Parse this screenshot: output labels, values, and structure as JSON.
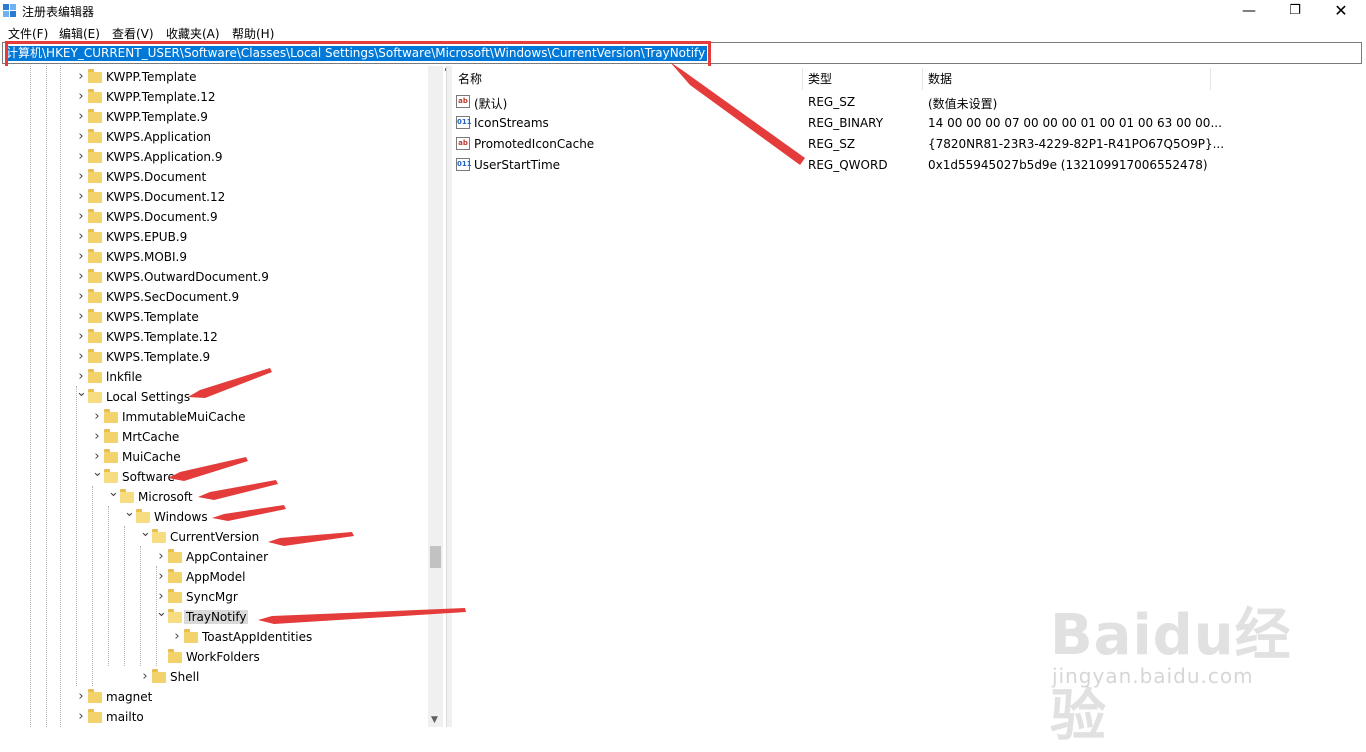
{
  "window": {
    "title": "注册表编辑器",
    "minimize_glyph": "—",
    "maximize_glyph": "❐",
    "close_glyph": "✕"
  },
  "menu": [
    "文件(F)",
    "编辑(E)",
    "查看(V)",
    "收藏夹(A)",
    "帮助(H)"
  ],
  "address": {
    "path": "计算机\\HKEY_CURRENT_USER\\Software\\Classes\\Local Settings\\Software\\Microsoft\\Windows\\CurrentVersion\\TrayNotify"
  },
  "tree": {
    "items": [
      {
        "label": "KWPP.Template",
        "state": "collapsed"
      },
      {
        "label": "KWPP.Template.12",
        "state": "collapsed"
      },
      {
        "label": "KWPP.Template.9",
        "state": "collapsed"
      },
      {
        "label": "KWPS.Application",
        "state": "collapsed"
      },
      {
        "label": "KWPS.Application.9",
        "state": "collapsed"
      },
      {
        "label": "KWPS.Document",
        "state": "collapsed"
      },
      {
        "label": "KWPS.Document.12",
        "state": "collapsed"
      },
      {
        "label": "KWPS.Document.9",
        "state": "collapsed"
      },
      {
        "label": "KWPS.EPUB.9",
        "state": "collapsed"
      },
      {
        "label": "KWPS.MOBI.9",
        "state": "collapsed"
      },
      {
        "label": "KWPS.OutwardDocument.9",
        "state": "collapsed"
      },
      {
        "label": "KWPS.SecDocument.9",
        "state": "collapsed"
      },
      {
        "label": "KWPS.Template",
        "state": "collapsed"
      },
      {
        "label": "KWPS.Template.12",
        "state": "collapsed"
      },
      {
        "label": "KWPS.Template.9",
        "state": "collapsed"
      },
      {
        "label": "lnkfile",
        "state": "collapsed"
      },
      {
        "label": "Local Settings",
        "state": "expanded"
      },
      {
        "label": "ImmutableMuiCache",
        "state": "collapsed"
      },
      {
        "label": "MrtCache",
        "state": "collapsed"
      },
      {
        "label": "MuiCache",
        "state": "collapsed"
      },
      {
        "label": "Software",
        "state": "expanded"
      },
      {
        "label": "Microsoft",
        "state": "expanded"
      },
      {
        "label": "Windows",
        "state": "expanded"
      },
      {
        "label": "CurrentVersion",
        "state": "expanded"
      },
      {
        "label": "AppContainer",
        "state": "collapsed"
      },
      {
        "label": "AppModel",
        "state": "collapsed"
      },
      {
        "label": "SyncMgr",
        "state": "collapsed"
      },
      {
        "label": "TrayNotify",
        "state": "expanded",
        "selected": true
      },
      {
        "label": "ToastAppIdentities",
        "state": "collapsed"
      },
      {
        "label": "WorkFolders",
        "state": "leaf"
      },
      {
        "label": "Shell",
        "state": "collapsed"
      },
      {
        "label": "magnet",
        "state": "collapsed"
      },
      {
        "label": "mailto",
        "state": "collapsed"
      }
    ]
  },
  "list": {
    "columns": {
      "name": "名称",
      "type": "类型",
      "data": "数据"
    },
    "rows": [
      {
        "icon": "string-value-icon",
        "icon_text": "ab",
        "name": "(默认)",
        "type": "REG_SZ",
        "data": "(数值未设置)"
      },
      {
        "icon": "binary-value-icon",
        "icon_text": "011",
        "name": "IconStreams",
        "type": "REG_BINARY",
        "data": "14 00 00 00 07 00 00 00 01 00 01 00 63 00 00..."
      },
      {
        "icon": "string-value-icon",
        "icon_text": "ab",
        "name": "PromotedIconCache",
        "type": "REG_SZ",
        "data": "{7820NR81-23R3-4229-82P1-R41PO67Q5O9P}..."
      },
      {
        "icon": "binary-value-icon",
        "icon_text": "011",
        "name": "UserStartTime",
        "type": "REG_QWORD",
        "data": "0x1d55945027b5d9e (132109917006552478)"
      }
    ]
  },
  "watermark": {
    "logo": "Baidu经验",
    "url": "jingyan.baidu.com"
  },
  "colors": {
    "accent": "#0078d7",
    "annotation_red": "#e43b3b",
    "folder": "#f3d16b"
  }
}
